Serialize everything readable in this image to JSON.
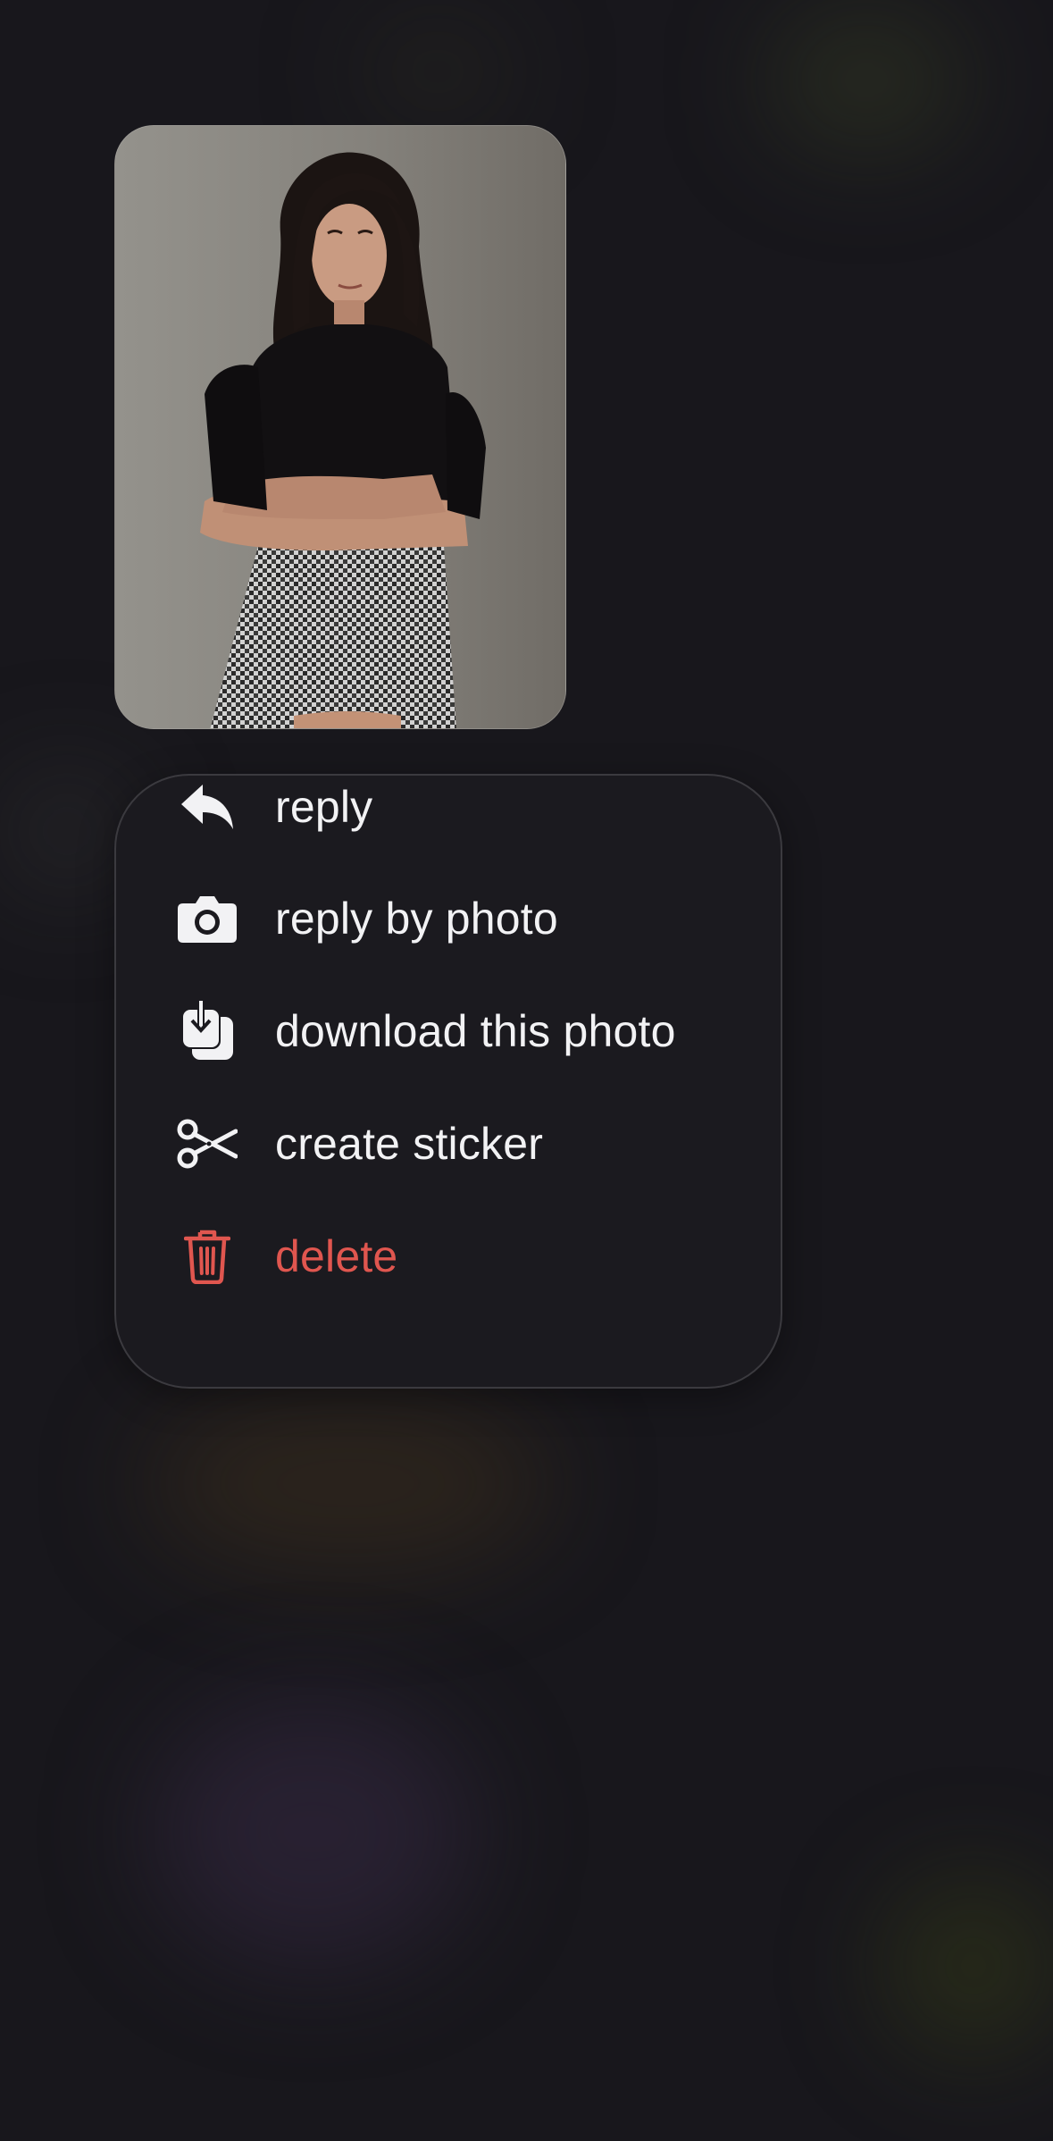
{
  "message": {
    "photo_icon": "portrait-photo"
  },
  "context_menu": {
    "items": [
      {
        "label": "reply",
        "icon": "reply-arrow-icon"
      },
      {
        "label": "reply by photo",
        "icon": "camera-icon"
      },
      {
        "label": "download this photo",
        "icon": "download-photo-icon"
      },
      {
        "label": "create sticker",
        "icon": "scissors-icon"
      },
      {
        "label": "delete",
        "icon": "trash-icon",
        "color": "#e0564f"
      }
    ]
  },
  "colors": {
    "background": "#18171c",
    "menu_background": "#1b1a1f",
    "text": "#f2f2f4",
    "danger": "#e0564f"
  }
}
